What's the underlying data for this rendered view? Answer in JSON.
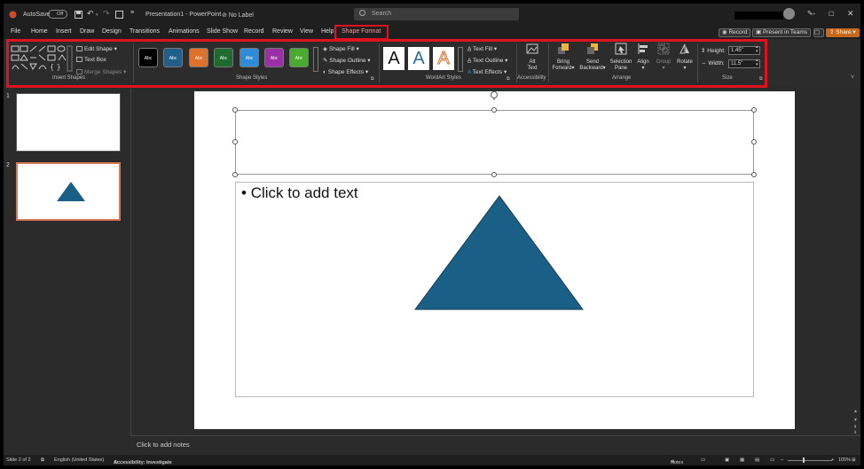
{
  "titlebar": {
    "autosave_label": "AutoSave",
    "autosave_state": "Off",
    "document_title": "Presentation1 - PowerPoint",
    "label_status": "No Label",
    "search_placeholder": "Search"
  },
  "tabs": [
    "File",
    "Home",
    "Insert",
    "Draw",
    "Design",
    "Transitions",
    "Animations",
    "Slide Show",
    "Record",
    "Review",
    "View",
    "Help",
    "Shape Format"
  ],
  "active_tab": "Shape Format",
  "tab_actions": {
    "record_label": "Record",
    "present_label": "Present in Teams",
    "share_label": "Share"
  },
  "ribbon": {
    "insert_shapes": {
      "edit_shape": "Edit Shape",
      "text_box": "Text Box",
      "merge_shapes": "Merge Shapes",
      "group_label": "Insert Shapes"
    },
    "shape_styles": {
      "swatches": [
        {
          "text": "Abc",
          "color": "#000000"
        },
        {
          "text": "Abc",
          "color": "#1f5f8a"
        },
        {
          "text": "Abc",
          "color": "#e0712a"
        },
        {
          "text": "Abc",
          "color": "#1e6b2f"
        },
        {
          "text": "Abc",
          "color": "#2e8bd8"
        },
        {
          "text": "Abc",
          "color": "#9b2fa5"
        },
        {
          "text": "Abc",
          "color": "#4aab2f"
        }
      ],
      "shape_fill": "Shape Fill",
      "shape_outline": "Shape Outline",
      "shape_effects": "Shape Effects",
      "group_label": "Shape Styles"
    },
    "wordart": {
      "letters": [
        "A",
        "A",
        "A"
      ],
      "text_fill": "Text Fill",
      "text_outline": "Text Outline",
      "text_effects": "Text Effects",
      "group_label": "WordArt Styles"
    },
    "accessibility": {
      "alt_text_line1": "Alt",
      "alt_text_line2": "Text",
      "group_label": "Accessibility"
    },
    "arrange": {
      "bring_forward_1": "Bring",
      "bring_forward_2": "Forward",
      "send_backward_1": "Send",
      "send_backward_2": "Backward",
      "selection_pane_1": "Selection",
      "selection_pane_2": "Pane",
      "align": "Align",
      "group": "Group",
      "rotate": "Rotate",
      "group_label": "Arrange"
    },
    "size": {
      "height_label": "Height:",
      "height_value": "1.45\"",
      "width_label": "Width:",
      "width_value": "11.5\"",
      "group_label": "Size"
    }
  },
  "thumbnails": [
    "1",
    "2"
  ],
  "slide": {
    "body_placeholder": "Click to add text",
    "bullet": "•",
    "shape_color": "#1a5f85"
  },
  "notes_placeholder": "Click to add notes",
  "status": {
    "slide_info": "Slide 2 of 2",
    "language": "English (United States)",
    "accessibility": "Accessibility: Investigate",
    "notes": "Notes",
    "zoom": "105%"
  }
}
